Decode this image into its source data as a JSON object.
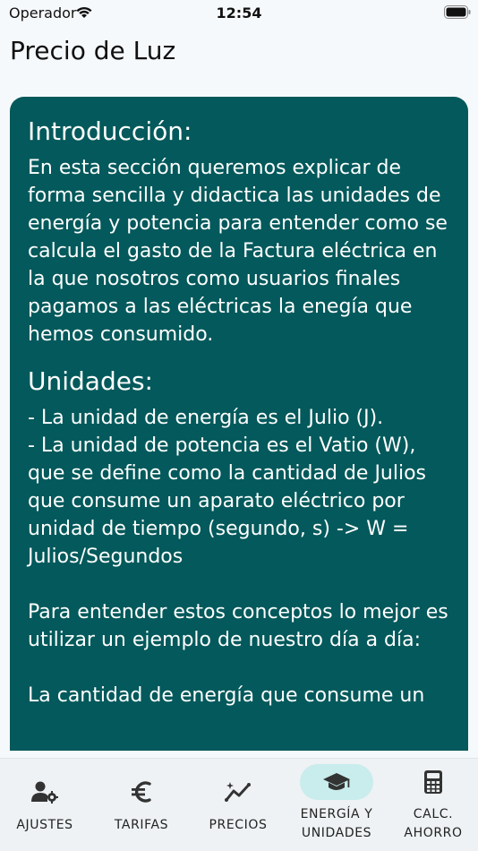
{
  "status": {
    "carrier": "Operador",
    "time": "12:54"
  },
  "app": {
    "title": "Precio de Luz"
  },
  "content": {
    "intro_heading": "Introducción:",
    "intro_text": "En esta sección queremos explicar de forma sencilla y didactica las unidades de energía y potencia para entender como se calcula el gasto de la Factura eléctrica en la que nosotros como usuarios finales pagamos a las eléctricas la enegía que hemos consumido.",
    "units_heading": "Unidades:",
    "units_text": "- La unidad de energía es el Julio (J).\n- La unidad de potencia es el Vatio (W), que se define como la cantidad de Julios que consume un aparato eléctrico por unidad de tiempo (segundo, s) -> W = Julios/Segundos\n\nPara entender estos conceptos lo mejor es utilizar un ejemplo de nuestro día a día:\n\nLa cantidad de energía que consume un"
  },
  "nav": {
    "items": [
      {
        "label": "AJUSTES",
        "icon": "user-settings-icon"
      },
      {
        "label": "TARIFAS",
        "icon": "euro-icon"
      },
      {
        "label": "PRECIOS",
        "icon": "chart-line-icon"
      },
      {
        "label_line1": "ENERGÍA Y",
        "label_line2": "UNIDADES",
        "icon": "graduation-cap-icon",
        "active": true
      },
      {
        "label_line1": "CALC.",
        "label_line2": "AHORRO",
        "icon": "calculator-icon"
      }
    ]
  },
  "colors": {
    "card": "#03595b",
    "active_pill": "#c9ecec",
    "nav_bg": "#eef2f4"
  }
}
